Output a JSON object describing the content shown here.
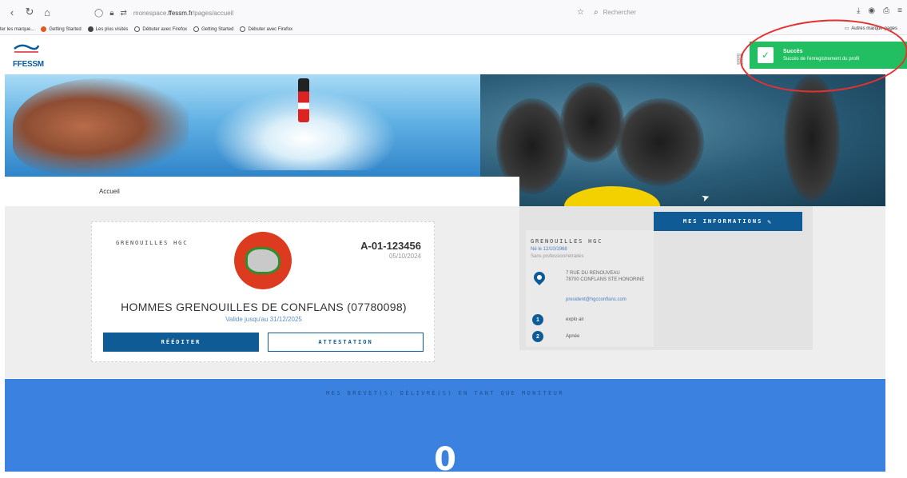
{
  "browser": {
    "url_prefix": "monespace.",
    "url_host": "ffessm.fr",
    "url_path": "/pages/accueil",
    "search_placeholder": "Rechercher",
    "bookmarks": [
      {
        "label": "ter les marque...",
        "color": "#cccccc"
      },
      {
        "label": "Getting Started",
        "color": "#e05a1f"
      },
      {
        "label": "Les plus visités",
        "color": "#444444"
      },
      {
        "label": "Débuter avec Firefox",
        "color": "#555555"
      },
      {
        "label": "Getting Started",
        "color": "#555555"
      },
      {
        "label": "Débuter avec Firefox",
        "color": "#555555"
      }
    ],
    "other_bookmarks": "Autres marque-pages"
  },
  "header": {
    "logo_text": "FFESSM"
  },
  "toast": {
    "title": "Succès",
    "message": "Succès de l'enregistrement du profil"
  },
  "breadcrumb": {
    "label": "Accueil"
  },
  "license": {
    "club_short": "GRENOUILLES HGC",
    "number": "A-01-123456",
    "date": "05/10/2024",
    "club_full": "HOMMES GRENOUILLES DE CONFLANS (07780098)",
    "valid_until": "Valide jusqu'au 31/12/2025",
    "reissue_label": "RÉÉDITER",
    "certificate_label": "ATTESTATION"
  },
  "info": {
    "button_label": "MES INFORMATIONS",
    "name": "GRENOUILLES HGC",
    "birth": "Né le 12/10/1968",
    "job": "Sans profession/retraités",
    "address_line1": "7 RUE DU RENOUVEAU",
    "address_line2": "78700 CONFLANS STE HONORINE",
    "email": "president@hgcconflans.com",
    "specialties": [
      {
        "num": "1",
        "label": "explo air"
      },
      {
        "num": "2",
        "label": "Apnée"
      }
    ]
  },
  "monitor_section": {
    "title": "MES BREVET(S) DÉLIVRÉ(S) EN TANT QUE MONITEUR",
    "count": "0"
  }
}
